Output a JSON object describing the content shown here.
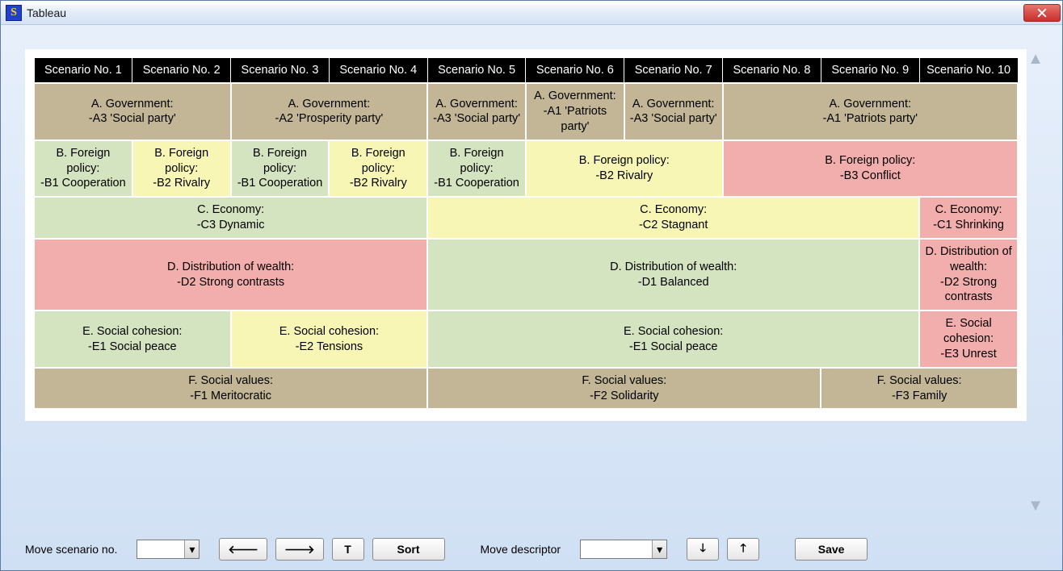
{
  "window": {
    "title": "Tableau",
    "app_icon_glyph": "S"
  },
  "headers": [
    "Scenario No. 1",
    "Scenario No. 2",
    "Scenario No. 3",
    "Scenario No. 4",
    "Scenario No. 5",
    "Scenario No. 6",
    "Scenario No. 7",
    "Scenario No. 8",
    "Scenario No. 9",
    "Scenario No. 10"
  ],
  "rows": {
    "A": [
      {
        "span": 2,
        "color": "tan",
        "line1": "A. Government:",
        "line2": "-A3 'Social party'"
      },
      {
        "span": 2,
        "color": "tan",
        "line1": "A. Government:",
        "line2": "-A2 'Prosperity party'"
      },
      {
        "span": 1,
        "color": "tan",
        "line1": "A. Government:",
        "line2": "-A3 'Social party'"
      },
      {
        "span": 1,
        "color": "tan",
        "line1": "A. Government:",
        "line2": "-A1 'Patriots party'"
      },
      {
        "span": 1,
        "color": "tan",
        "line1": "A. Government:",
        "line2": "-A3 'Social party'"
      },
      {
        "span": 3,
        "color": "tan",
        "line1": "A. Government:",
        "line2": "-A1 'Patriots party'"
      }
    ],
    "B": [
      {
        "span": 1,
        "color": "green",
        "line1": "B. Foreign policy:",
        "line2": "-B1 Cooperation"
      },
      {
        "span": 1,
        "color": "yellow",
        "line1": "B. Foreign policy:",
        "line2": "-B2 Rivalry"
      },
      {
        "span": 1,
        "color": "green",
        "line1": "B. Foreign policy:",
        "line2": "-B1 Cooperation"
      },
      {
        "span": 1,
        "color": "yellow",
        "line1": "B. Foreign policy:",
        "line2": "-B2 Rivalry"
      },
      {
        "span": 1,
        "color": "green",
        "line1": "B. Foreign policy:",
        "line2": "-B1 Cooperation"
      },
      {
        "span": 2,
        "color": "yellow",
        "line1": "B. Foreign policy:",
        "line2": "-B2 Rivalry"
      },
      {
        "span": 3,
        "color": "pink",
        "line1": "B. Foreign policy:",
        "line2": "-B3 Conflict"
      }
    ],
    "C": [
      {
        "span": 4,
        "color": "green",
        "line1": "C. Economy:",
        "line2": "-C3 Dynamic"
      },
      {
        "span": 5,
        "color": "yellow",
        "line1": "C. Economy:",
        "line2": "-C2 Stagnant"
      },
      {
        "span": 1,
        "color": "pink",
        "line1": "C. Economy:",
        "line2": "-C1 Shrinking"
      }
    ],
    "D": [
      {
        "span": 4,
        "color": "pink",
        "line1": "D. Distribution of wealth:",
        "line2": "-D2 Strong contrasts"
      },
      {
        "span": 5,
        "color": "green",
        "line1": "D. Distribution of wealth:",
        "line2": "-D1 Balanced"
      },
      {
        "span": 1,
        "color": "pink",
        "line1": "D. Distribution of wealth:",
        "line2": "-D2 Strong contrasts"
      }
    ],
    "E": [
      {
        "span": 2,
        "color": "green",
        "line1": "E. Social cohesion:",
        "line2": "-E1 Social peace"
      },
      {
        "span": 2,
        "color": "yellow",
        "line1": "E. Social cohesion:",
        "line2": "-E2 Tensions"
      },
      {
        "span": 5,
        "color": "green",
        "line1": "E. Social cohesion:",
        "line2": "-E1 Social peace"
      },
      {
        "span": 1,
        "color": "pink",
        "line1": "E. Social cohesion:",
        "line2": "-E3 Unrest"
      }
    ],
    "F": [
      {
        "span": 4,
        "color": "tan",
        "line1": "F. Social values:",
        "line2": "-F1 Meritocratic"
      },
      {
        "span": 4,
        "color": "tan",
        "line1": "F. Social values:",
        "line2": "-F2 Solidarity"
      },
      {
        "span": 2,
        "color": "tan",
        "line1": "F. Social values:",
        "line2": "-F3 Family"
      }
    ]
  },
  "toolbar": {
    "move_scenario_label": "Move scenario no.",
    "move_descriptor_label": "Move descriptor",
    "btn_left": "🡐",
    "btn_right": "🡒",
    "btn_T": "T",
    "btn_sort": "Sort",
    "btn_down": "🡓",
    "btn_up": "🡑",
    "btn_save": "Save",
    "scenario_value": "",
    "descriptor_value": ""
  }
}
